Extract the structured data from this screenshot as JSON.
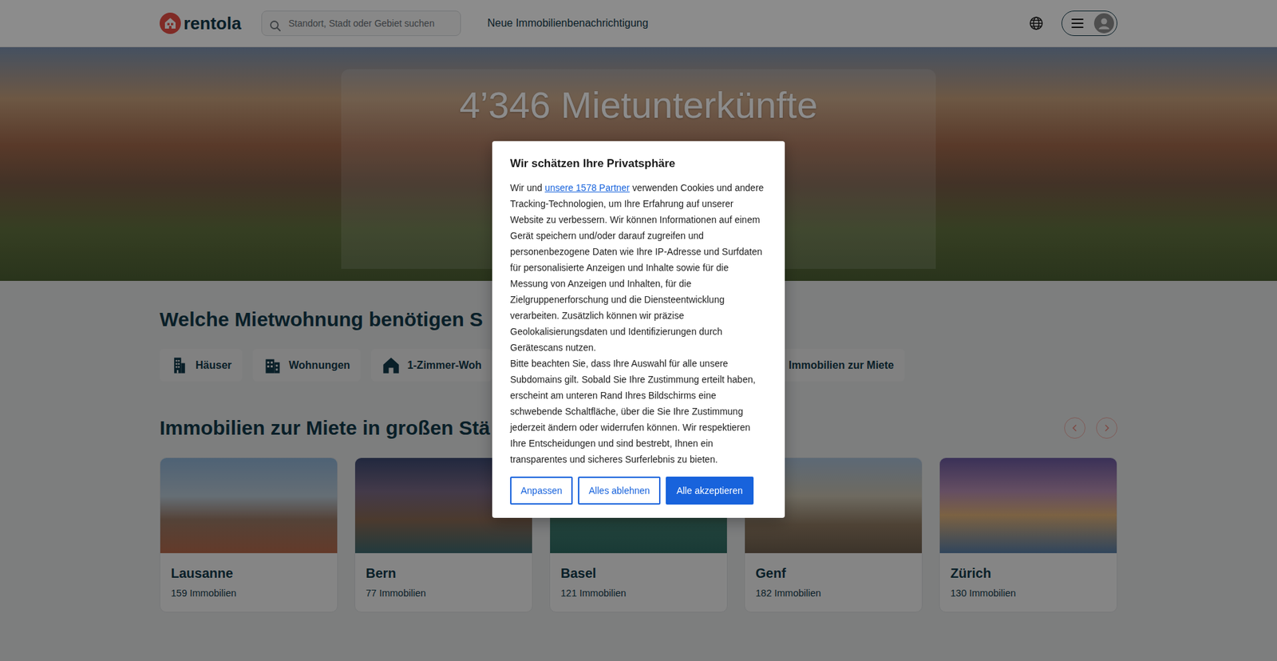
{
  "header": {
    "logo": "rentola",
    "search": {
      "placeholder": "Standort, Stadt oder Gebiet suchen"
    },
    "nav_link": "Neue Immobilienbenachrichtigung"
  },
  "hero": {
    "title": "4’346 Mietunterkünfte"
  },
  "categories": {
    "heading": "Welche Mietwohnung benötigen S",
    "items": [
      {
        "label": "Häuser"
      },
      {
        "label": "Wohnungen"
      },
      {
        "label": "1-Zimmer-Woh"
      },
      {
        "label": "Immobilien zur Miete"
      }
    ]
  },
  "cities": {
    "heading": "Immobilien zur Miete in großen Stä",
    "items": [
      {
        "name": "Lausanne",
        "count": "159 Immobilien"
      },
      {
        "name": "Bern",
        "count": "77 Immobilien"
      },
      {
        "name": "Basel",
        "count": "121 Immobilien"
      },
      {
        "name": "Genf",
        "count": "182 Immobilien"
      },
      {
        "name": "Zürich",
        "count": "130 Immobilien"
      }
    ]
  },
  "consent": {
    "title": "Wir schätzen Ihre Privatsphäre",
    "text_before_link": "Wir und ",
    "link": "unsere 1578 Partner",
    "text_after_link": " verwenden Cookies und andere Tracking-Technologien, um Ihre Erfahrung auf unserer Website zu verbessern. Wir können Informationen auf einem Gerät speichern und/oder darauf zugreifen und personenbezogene Daten wie Ihre IP-Adresse und Surfdaten für personalisierte Anzeigen und Inhalte sowie für die Messung von Anzeigen und Inhalten, für die Zielgruppenerforschung und die Diensteentwicklung verarbeiten. Zusätzlich können wir präzise Geolokalisierungsdaten und Identifizierungen durch Gerätescans nutzen.",
    "paragraph2": "Bitte beachten Sie, dass Ihre Auswahl für alle unsere Subdomains gilt. Sobald Sie Ihre Zustimmung erteilt haben, erscheint am unteren Rand Ihres Bildschirms eine schwebende Schaltfläche, über die Sie Ihre Zustimmung jederzeit ändern oder widerrufen können. Wir respektieren Ihre Entscheidungen und sind bestrebt, Ihnen ein transparentes und sicheres Surferlebnis zu bieten.",
    "buttons": [
      {
        "label": "Anpassen",
        "kind": "outline"
      },
      {
        "label": "Alles ablehnen",
        "kind": "outline"
      },
      {
        "label": "Alle akzeptieren",
        "kind": "filled"
      }
    ]
  }
}
